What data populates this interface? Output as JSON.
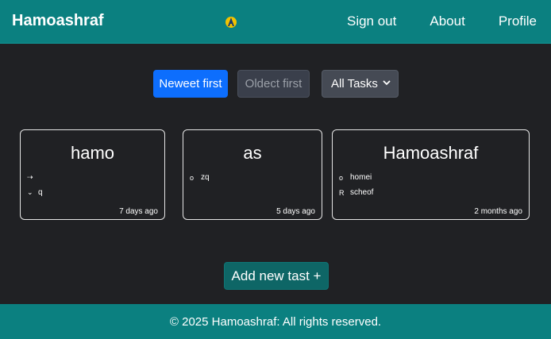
{
  "navbar": {
    "brand": "Hamoashraf",
    "logo_icon": "app-logo-icon",
    "links": [
      "Sign out",
      "About",
      "Profile"
    ]
  },
  "toolbar": {
    "newest_label": "Neweet first",
    "oldest_label": "Oldect first",
    "filter_value": "All Tasks"
  },
  "cards": [
    {
      "title": "hamo",
      "items": [
        {
          "bullet": "⇢",
          "text": ""
        },
        {
          "bullet": "⌄",
          "text": "q"
        }
      ],
      "time": "7 days ago"
    },
    {
      "title": "as",
      "items": [
        {
          "bullet": "o",
          "text": "zq"
        }
      ],
      "time": "5 days ago"
    },
    {
      "title": "Hamoashraf",
      "items": [
        {
          "bullet": "o",
          "text": "homei"
        },
        {
          "bullet": "R",
          "text": "scheof"
        }
      ],
      "time": "2 months ago"
    }
  ],
  "add_button_label": "Add new tast +",
  "footer_text": "© 2025 Hamoashraf: All rights reserved.",
  "colors": {
    "navbar": "#0b8080",
    "background": "#202124",
    "primary": "#0d6efd",
    "add_button": "#0e6666"
  }
}
